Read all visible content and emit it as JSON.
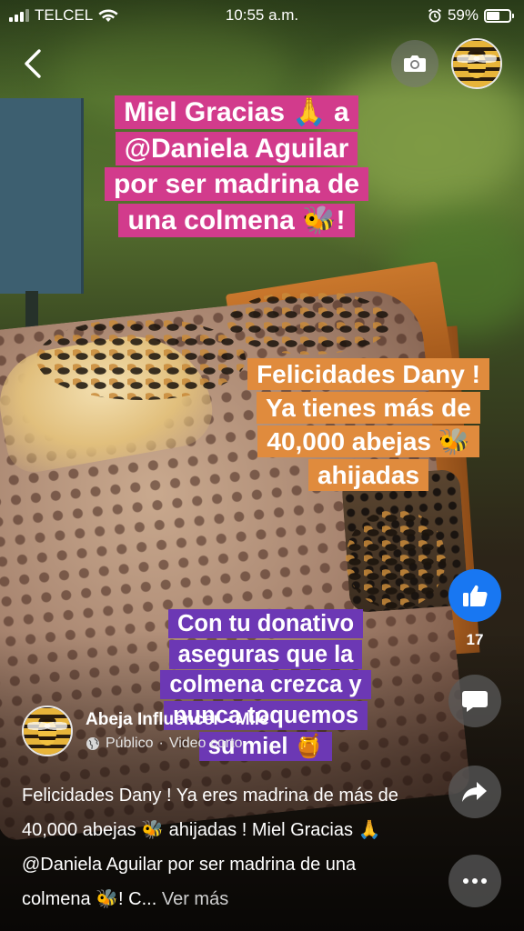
{
  "status_bar": {
    "carrier": "TELCEL",
    "time": "10:55 a.m.",
    "battery_percent": "59%",
    "battery_level": 0.59,
    "icons": [
      "signal-icon",
      "wifi-icon",
      "alarm-icon",
      "battery-icon"
    ]
  },
  "header": {
    "back_icon": "chevron-left-icon",
    "camera_icon": "camera-icon"
  },
  "stickers": {
    "pink": [
      "Miel Gracias 🙏 a",
      "@Daniela Aguilar",
      "por ser madrina de",
      "una colmena 🐝!"
    ],
    "orange": [
      "Felicidades Dany !",
      "Ya tienes más de",
      "40,000 abejas 🐝",
      "ahijadas"
    ],
    "purple": [
      "Con tu donativo",
      "aseguras que la",
      "colmena crezca y",
      "nunca toquemos",
      "su miel 🍯"
    ]
  },
  "actions": {
    "like_count": "17",
    "icons": [
      "like-icon",
      "comment-icon",
      "share-icon",
      "more-icon"
    ]
  },
  "post": {
    "author": "Abeja Influencer - Mile",
    "privacy": "Público",
    "separator": "·",
    "type": "Video corto",
    "caption": "Felicidades Dany ! Ya eres madrina de más de 40,000 abejas 🐝 ahijadas ! Miel Gracias 🙏  @Daniela Aguilar por ser madrina de una colmena 🐝! C...",
    "see_more": "Ver más"
  },
  "colors": {
    "like_blue": "#1877f2",
    "sticker_pink": "#d23b8c",
    "sticker_orange": "#e08b3d",
    "sticker_purple": "#6c38b4"
  }
}
